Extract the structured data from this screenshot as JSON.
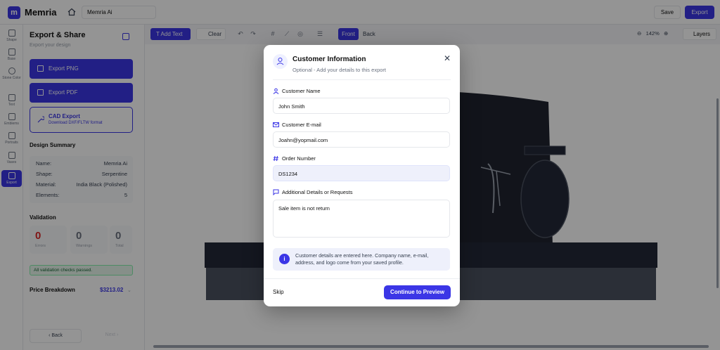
{
  "app": {
    "logo_letter": "m",
    "name": "Memria",
    "project_name": "Memria Ai"
  },
  "topbar": {
    "save_label": "Save",
    "export_label": "Export"
  },
  "rail": {
    "items": [
      {
        "label": "Shape",
        "icon": "square-icon"
      },
      {
        "label": "Base",
        "icon": "layers-icon"
      },
      {
        "label": "Stone Color",
        "icon": "palette-icon"
      },
      {
        "label": "Text",
        "icon": "text-icon"
      },
      {
        "label": "Emblems",
        "icon": "emblem-icon"
      },
      {
        "label": "Portraits",
        "icon": "image-icon"
      },
      {
        "label": "Vases",
        "icon": "vase-icon"
      },
      {
        "label": "Export",
        "icon": "download-icon"
      }
    ]
  },
  "panel": {
    "title": "Export & Share",
    "subtitle": "Export your design",
    "export_png": "Export PNG",
    "export_pdf": "Export PDF",
    "cad_title": "CAD Export",
    "cad_sub": "Download DXF/FLTW format",
    "summary_title": "Design Summary",
    "summary": [
      {
        "label": "Name:",
        "value": "Memria Ai"
      },
      {
        "label": "Shape:",
        "value": "Serpentine"
      },
      {
        "label": "Material:",
        "value": "India Black (Polished)"
      },
      {
        "label": "Elements:",
        "value": "5"
      }
    ],
    "validation_title": "Validation",
    "validation": [
      {
        "num": "0",
        "label": "Errors"
      },
      {
        "num": "0",
        "label": "Warnings"
      },
      {
        "num": "0",
        "label": "Total"
      }
    ],
    "validation_msg": "All validation checks passed.",
    "price_label": "Price Breakdown",
    "price_value": "$3213.02",
    "back_label": "Back",
    "next_label": "Next"
  },
  "toolbar": {
    "add_text": "Add Text",
    "clear": "Clear",
    "front": "Front",
    "back": "Back",
    "zoom": "142%",
    "layers": "Layers"
  },
  "modal": {
    "title": "Customer Information",
    "subtitle": "Optional - Add your details to this export",
    "name_label": "Customer Name",
    "name_value": "John Smith",
    "email_label": "Customer E-mail",
    "email_value": "Joahn@yopmail.com",
    "order_label": "Order Number",
    "order_value": "DS1234",
    "details_label": "Additional Details or Requests",
    "details_value": "Sale item is not return",
    "info_text": "Customer details are entered here. Company name, e-mail, address, and logo come from your saved profile.",
    "skip_label": "Skip",
    "continue_label": "Continue to Preview"
  },
  "colors": {
    "accent": "#3b36e6",
    "success_bg": "#e7f6ec",
    "error": "#dc2626"
  }
}
